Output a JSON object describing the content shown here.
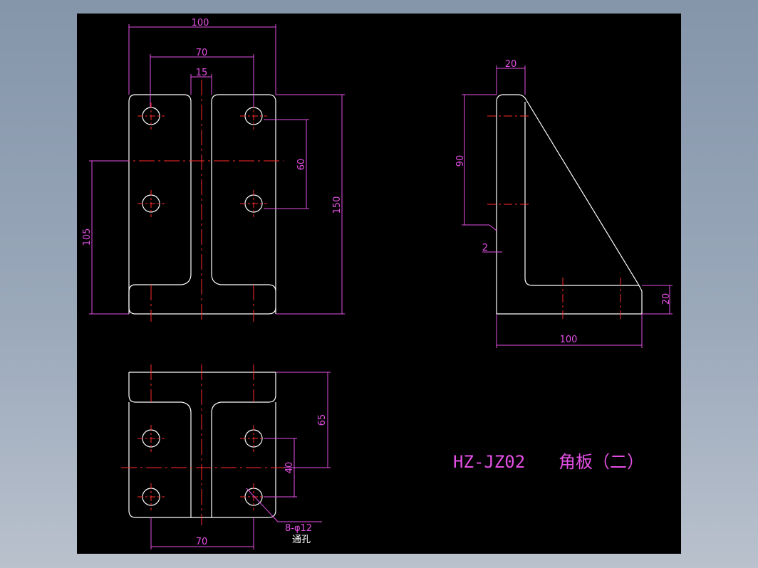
{
  "drawing": {
    "title_code": "HZ-JZ02",
    "title_name": "角板（二）",
    "colors": {
      "background_outer": "#8fa0b4",
      "canvas": "#000000",
      "outline": "#ffffff",
      "center_line": "#ff2a2a",
      "dimension": "#e54fe5"
    },
    "front_view": {
      "dims": {
        "overall_width": "100",
        "bolt_spacing": "70",
        "web_thickness": "15",
        "hole_pitch_vertical": "60",
        "overall_height": "150",
        "center_height": "105"
      }
    },
    "side_view": {
      "dims": {
        "top_thickness": "20",
        "hole_distance": "90",
        "offset": "2",
        "base_thickness": "20",
        "base_length": "100"
      }
    },
    "bottom_view": {
      "dims": {
        "depth": "65",
        "hole_pitch": "40",
        "bolt_spacing": "70",
        "hole_spec": "8-φ12",
        "hole_note": "通孔"
      }
    }
  }
}
